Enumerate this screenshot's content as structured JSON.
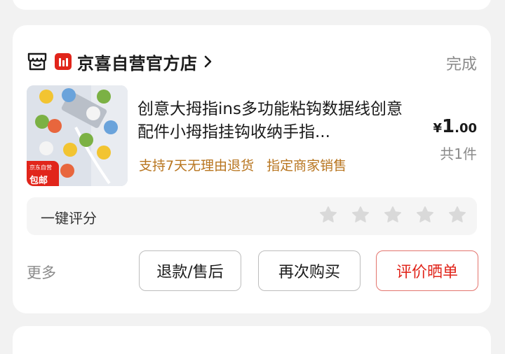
{
  "order": {
    "store": {
      "name": "京喜自营官方店",
      "icon": "storefront-icon",
      "brand_icon": "jx-logo-icon"
    },
    "status": "完成",
    "product": {
      "title": "创意大拇指ins多功能粘钩数据线创意配件小拇指挂钩收纳手指...",
      "thumbnail_badge_small": "京东自营",
      "thumbnail_badge_large": "包邮",
      "tags": [
        "支持7天无理由退货",
        "指定商家销售"
      ],
      "price_currency": "¥",
      "price_int": "1",
      "price_dec": ".00",
      "quantity": "共1件"
    },
    "rating": {
      "label": "一键评分",
      "stars_max": 5,
      "stars_selected": 0
    },
    "actions": {
      "more": "更多",
      "refund": "退款/售后",
      "rebuy": "再次购买",
      "review": "评价晒单"
    }
  },
  "colors": {
    "accent": "#e1251b",
    "tag": "#b8751f",
    "muted": "#8a8a8a",
    "background": "#f2f2f2"
  }
}
